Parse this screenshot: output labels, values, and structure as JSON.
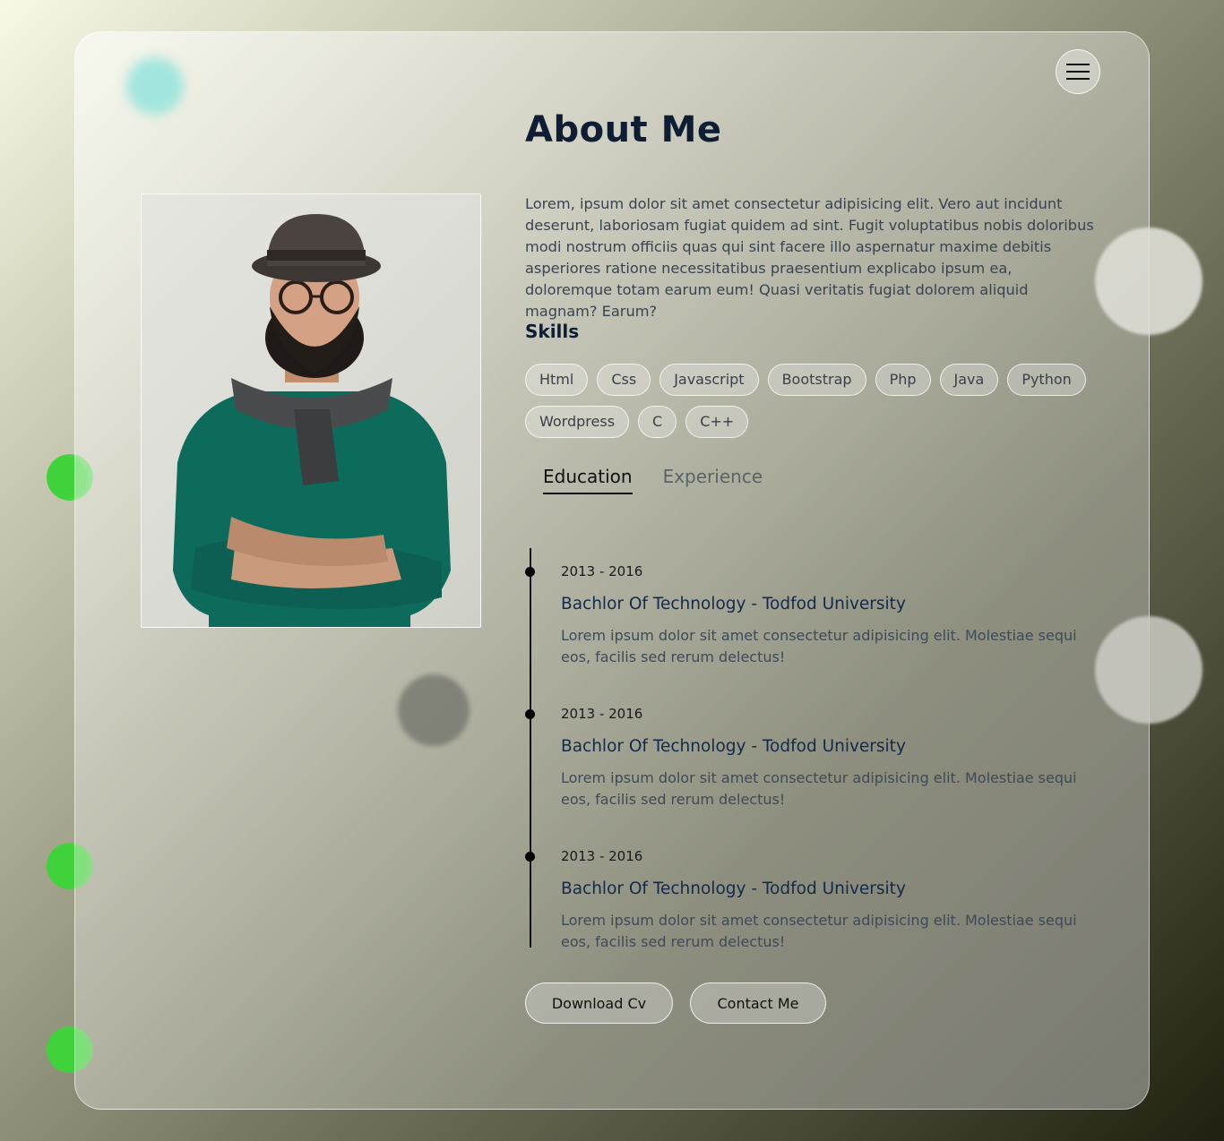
{
  "header": {
    "title": "About Me",
    "menu_icon": "hamburger-menu-icon"
  },
  "intro": "Lorem, ipsum dolor sit amet consectetur adipisicing elit. Vero aut incidunt deserunt, laboriosam fugiat quidem ad sint. Fugit voluptatibus nobis doloribus modi nostrum officiis quas qui sint facere illo aspernatur maxime debitis asperiores ratione necessitatibus praesentium explicabo ipsum ea, doloremque totam earum eum! Quasi veritatis fugiat dolorem aliquid magnam? Earum?",
  "skills": {
    "heading": "Skills",
    "items": [
      "Html",
      "Css",
      "Javascript",
      "Bootstrap",
      "Php",
      "Java",
      "Python",
      "Wordpress",
      "C",
      "C++"
    ]
  },
  "tabs": [
    {
      "label": "Education",
      "active": true
    },
    {
      "label": "Experience",
      "active": false
    }
  ],
  "timeline": [
    {
      "date": "2013 - 2016",
      "title": "Bachlor Of Technology - Todfod University",
      "desc": "Lorem ipsum dolor sit amet consectetur adipisicing elit. Molestiae sequi eos, facilis sed rerum delectus!"
    },
    {
      "date": "2013 - 2016",
      "title": "Bachlor Of Technology - Todfod University",
      "desc": "Lorem ipsum dolor sit amet consectetur adipisicing elit. Molestiae sequi eos, facilis sed rerum delectus!"
    },
    {
      "date": "2013 - 2016",
      "title": "Bachlor Of Technology - Todfod University",
      "desc": "Lorem ipsum dolor sit amet consectetur adipisicing elit. Molestiae sequi eos, facilis sed rerum delectus!"
    }
  ],
  "actions": {
    "download": "Download Cv",
    "contact": "Contact Me"
  },
  "colors": {
    "heading": "#0e1d33",
    "accent_green": "#3fd23a",
    "timeline_title": "#15294a"
  }
}
